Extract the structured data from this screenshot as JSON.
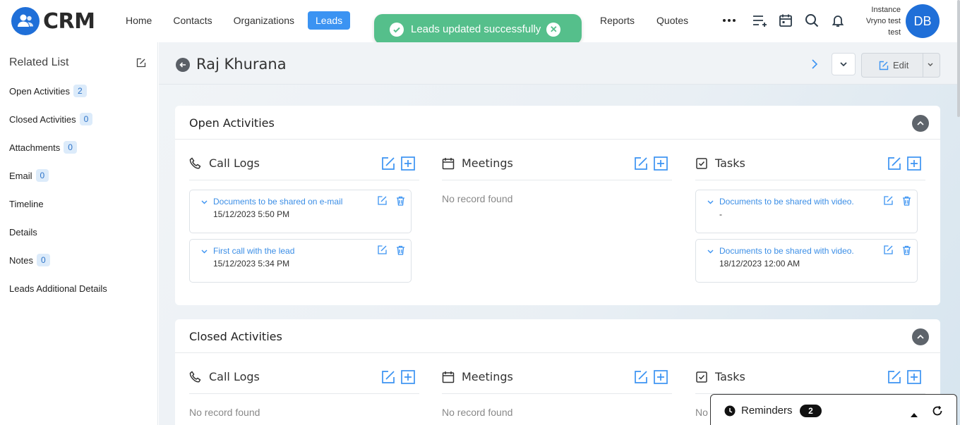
{
  "app": {
    "logo_text": "CRM"
  },
  "nav": [
    {
      "label": "Home",
      "active": false
    },
    {
      "label": "Contacts",
      "active": false
    },
    {
      "label": "Organizations",
      "active": false
    },
    {
      "label": "Leads",
      "active": true
    },
    {
      "label": "Reports",
      "active": false
    },
    {
      "label": "Quotes",
      "active": false
    }
  ],
  "toast": {
    "message": "Leads updated successfully"
  },
  "user": {
    "instance_line1": "Instance",
    "instance_line2": "Vryno test",
    "instance_line3": "test",
    "initials": "DB"
  },
  "sidebar": {
    "title": "Related List",
    "items": [
      {
        "label": "Open Activities",
        "count": "2"
      },
      {
        "label": "Closed Activities",
        "count": "0"
      },
      {
        "label": "Attachments",
        "count": "0"
      },
      {
        "label": "Email",
        "count": "0"
      },
      {
        "label": "Timeline",
        "count": null
      },
      {
        "label": "Details",
        "count": null
      },
      {
        "label": "Notes",
        "count": "0"
      },
      {
        "label": "Leads Additional Details",
        "count": null
      }
    ]
  },
  "record": {
    "title": "Raj Khurana",
    "edit_label": "Edit"
  },
  "open_activities": {
    "title": "Open Activities",
    "call_logs": {
      "title": "Call Logs",
      "records": [
        {
          "name": "Documents to be shared on e-mail",
          "date": "15/12/2023 5:50 PM"
        },
        {
          "name": "First call with the lead",
          "date": "15/12/2023 5:34 PM"
        }
      ]
    },
    "meetings": {
      "title": "Meetings",
      "empty": "No record found"
    },
    "tasks": {
      "title": "Tasks",
      "records": [
        {
          "name": "Documents to be shared with video.",
          "date": "-"
        },
        {
          "name": "Documents to be shared with video.",
          "date": "18/12/2023 12:00 AM"
        }
      ]
    }
  },
  "closed_activities": {
    "title": "Closed Activities",
    "call_logs": {
      "title": "Call Logs",
      "empty": "No record found"
    },
    "meetings": {
      "title": "Meetings",
      "empty": "No record found"
    },
    "tasks": {
      "title": "Tasks",
      "empty": "No"
    }
  },
  "reminders": {
    "label": "Reminders",
    "count": "2"
  },
  "colors": {
    "brand": "#1f6fd8",
    "accent": "#3b93f2",
    "toast": "#55bf8b",
    "link": "#3b8ee6"
  }
}
